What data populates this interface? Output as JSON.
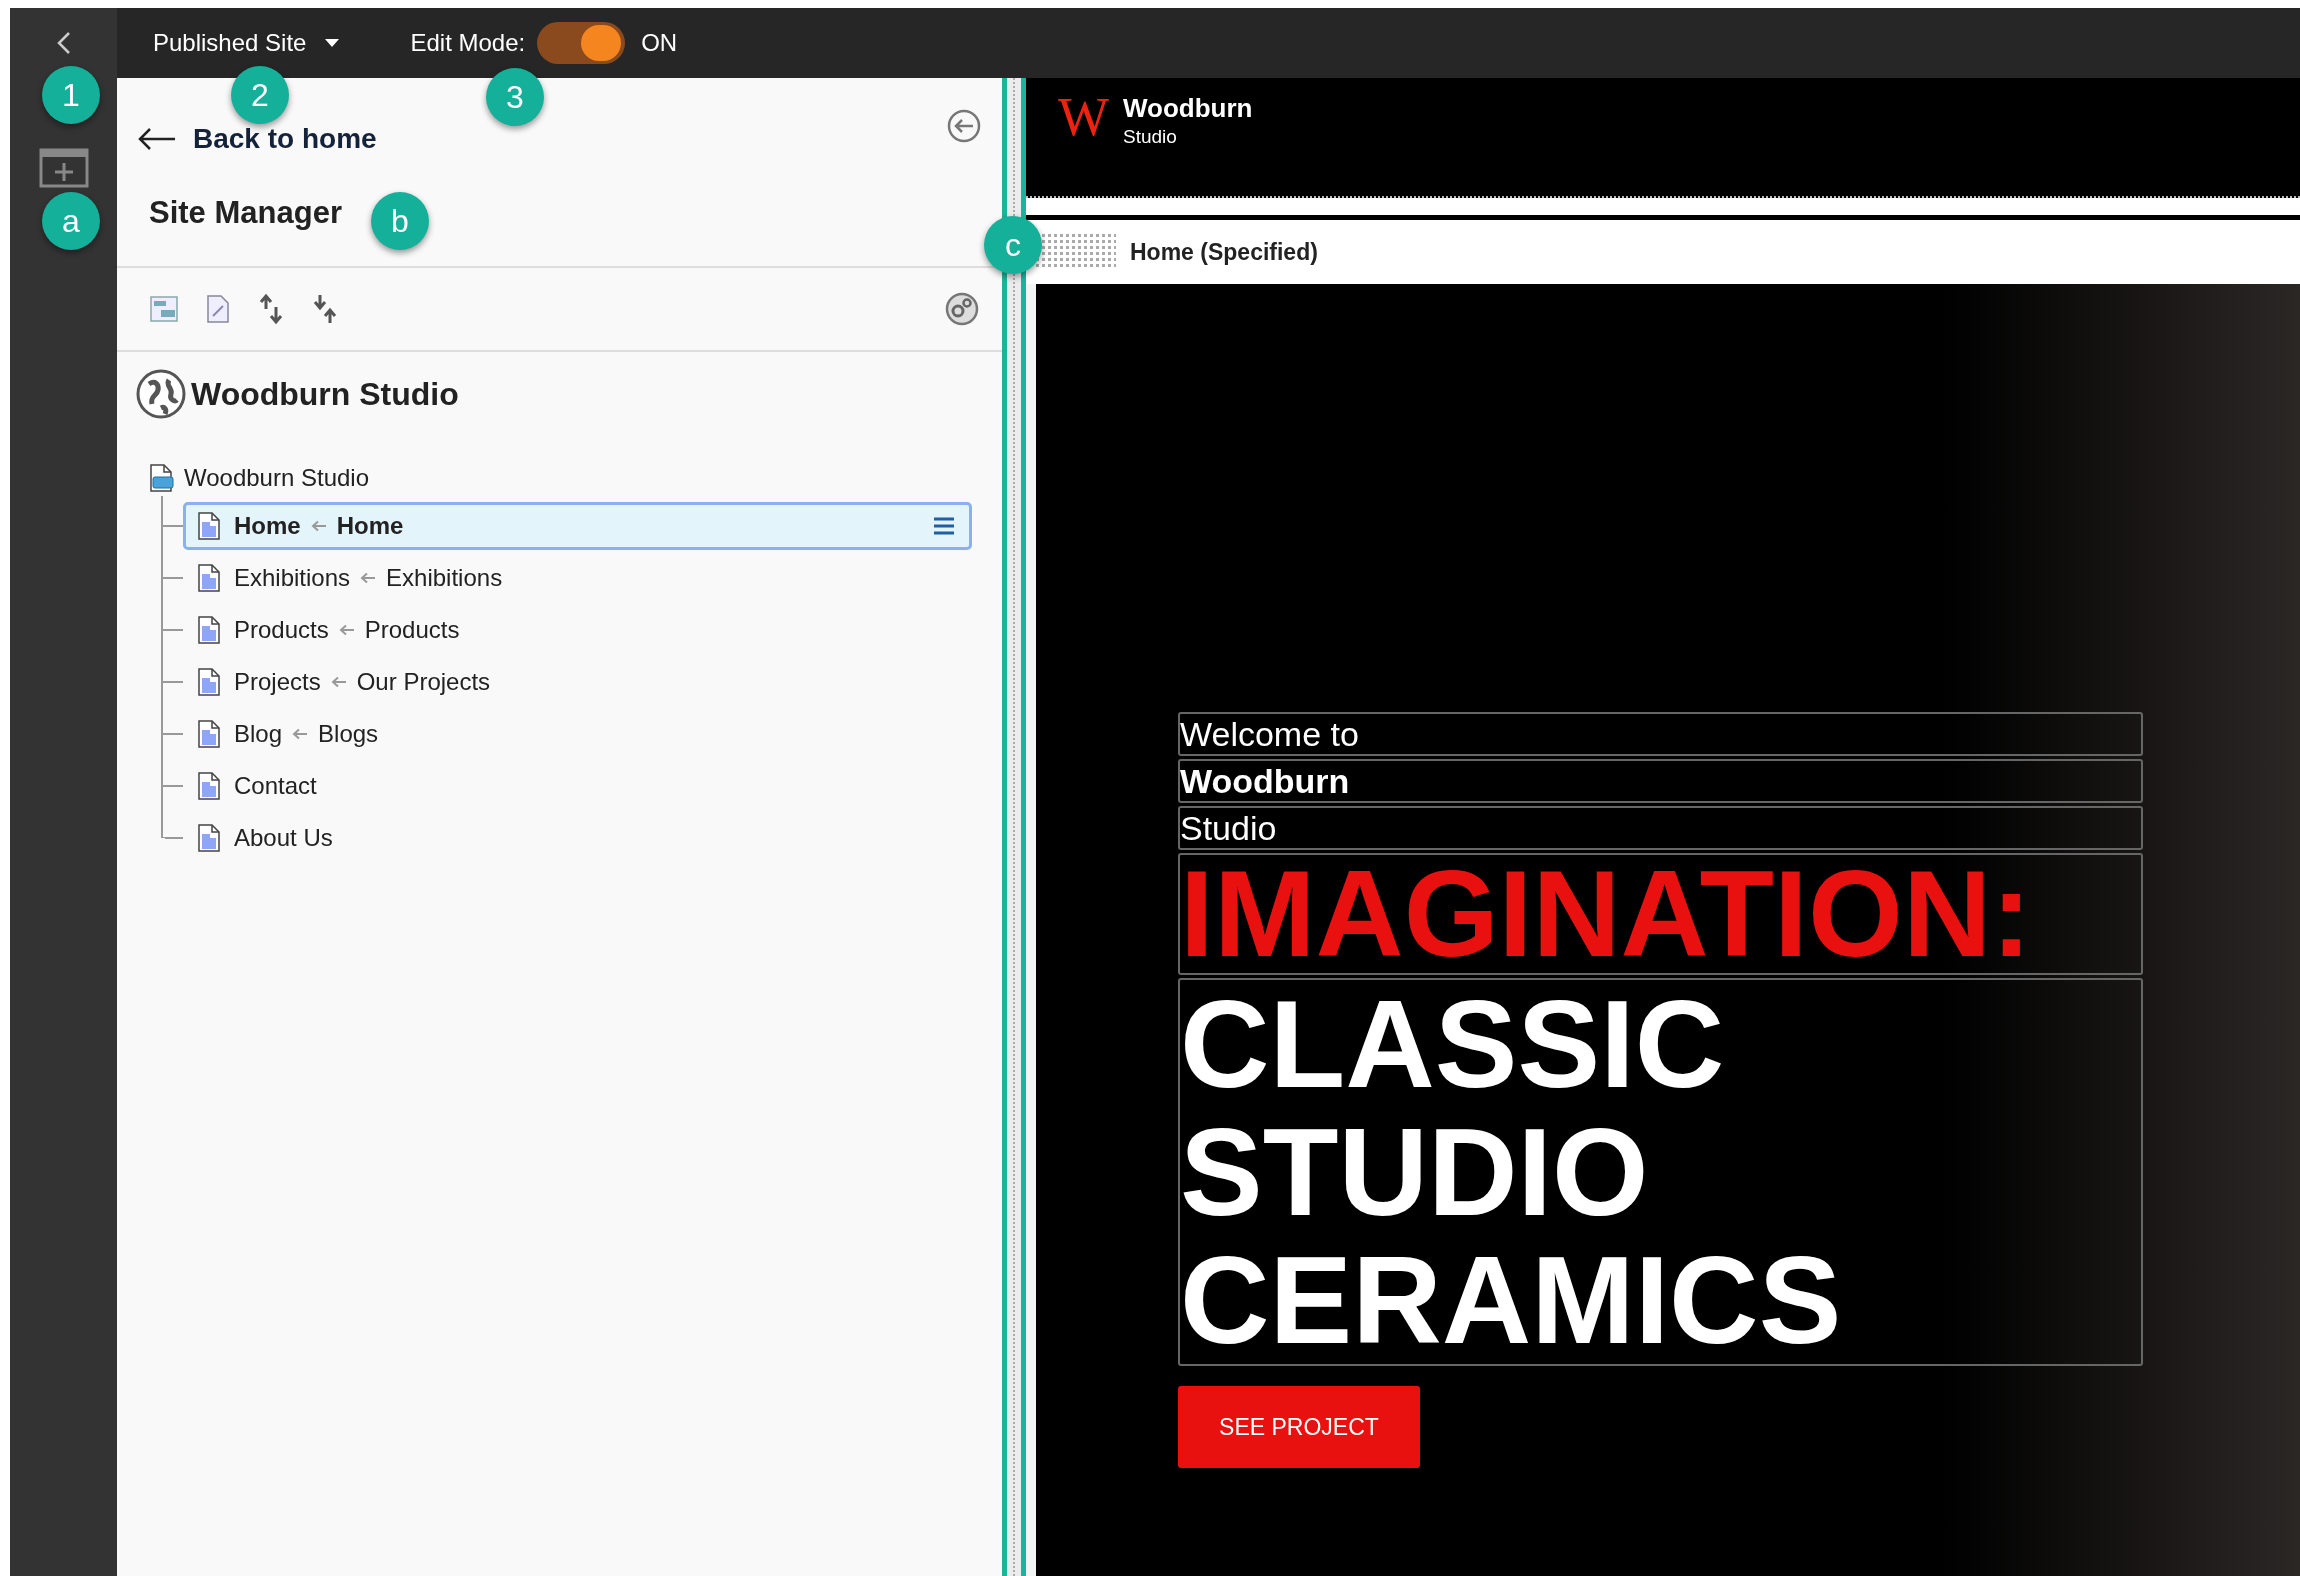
{
  "topbar": {
    "site_menu": "Published Site",
    "edit_mode": {
      "label": "Edit Mode:",
      "on": true,
      "state_text": "ON"
    }
  },
  "callouts": [
    {
      "label": "1"
    },
    {
      "label": "2"
    },
    {
      "label": "3"
    },
    {
      "label": "a"
    },
    {
      "label": "b"
    },
    {
      "label": "c"
    }
  ],
  "panel": {
    "back_link": "Back to home",
    "title": "Site Manager",
    "site_name": "Woodburn Studio"
  },
  "tree": {
    "label": "Woodburn Studio",
    "children": [
      {
        "label": "Home",
        "target": "Home",
        "selected": true
      },
      {
        "label": "Exhibitions",
        "target": "Exhibitions",
        "selected": false
      },
      {
        "label": "Products",
        "target": "Products",
        "selected": false
      },
      {
        "label": "Projects",
        "target": "Our Projects",
        "selected": false
      },
      {
        "label": "Blog",
        "target": "Blogs",
        "selected": false
      },
      {
        "label": "Contact",
        "selected": false
      },
      {
        "label": "About Us",
        "selected": false
      }
    ]
  },
  "preview": {
    "logo": {
      "mark": "W",
      "name": "Woodburn",
      "tagline": "Studio"
    },
    "page_label": "Home (Specified)",
    "hero": {
      "intro": [
        {
          "text": "Welcome to",
          "kind": "light"
        },
        {
          "text": "Woodburn",
          "kind": "bold"
        },
        {
          "text": "Studio",
          "kind": "light"
        }
      ],
      "accent": "IMAGINATION:",
      "headline": "CLASSIC STUDIO CERAMICS",
      "button": "SEE PROJECT"
    }
  }
}
